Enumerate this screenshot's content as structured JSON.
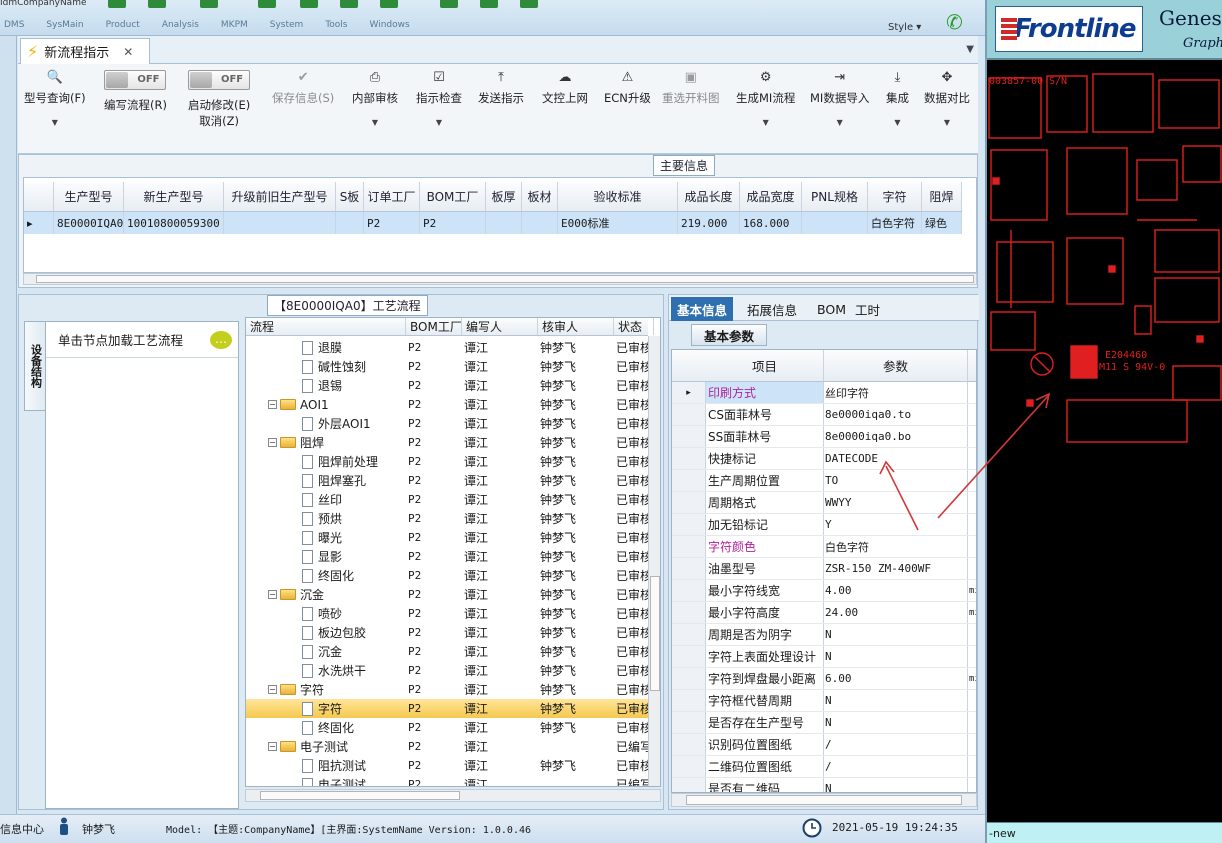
{
  "app": {
    "company": "IdmCompanyName",
    "menus": [
      "DMS",
      "SysMain",
      "Product",
      "Analysis",
      "MKPM",
      "System",
      "Tools",
      "Windows"
    ],
    "style_menu": "Style ▾"
  },
  "tab": {
    "title": "新流程指示",
    "close": "✕",
    "dropdown": "▼"
  },
  "toolbar": {
    "items": [
      {
        "label": "型号查询(F)",
        "icon": "🔍"
      },
      {
        "label": "编写流程(R)",
        "toggle": "OFF"
      },
      {
        "label": "启动修改(E)",
        "label2": "取消(Z)",
        "toggle": "OFF"
      },
      {
        "label": "保存信息(S)",
        "icon": "✔"
      },
      {
        "label": "内部审核",
        "icon": "⎙"
      },
      {
        "label": "指示检查",
        "icon": "☑"
      },
      {
        "label": "发送指示",
        "icon": "⤒"
      },
      {
        "label": "文控上网",
        "icon": "☁"
      },
      {
        "label": "ECN升级",
        "icon": "⚠"
      },
      {
        "label": "重选开料图",
        "icon": "▣"
      },
      {
        "label": "生成MI流程",
        "icon": "⚙"
      },
      {
        "label": "MI数据导入",
        "icon": "⇥"
      },
      {
        "label": "集成",
        "icon": "⤓"
      },
      {
        "label": "数据对比",
        "icon": "✥"
      }
    ]
  },
  "main_info": {
    "title": "主要信息",
    "columns": [
      "生产型号",
      "新生产型号",
      "升级前旧生产型号",
      "S板",
      "订单工厂",
      "BOM工厂",
      "板厚",
      "板材",
      "验收标准",
      "成品长度",
      "成品宽度",
      "PNL规格",
      "字符",
      "阻焊"
    ],
    "row": [
      "8E0000IQA0",
      "10010800059300",
      "",
      "",
      "P2",
      "P2",
      "",
      "",
      "E000标准",
      "219.000",
      "168.000",
      "",
      "白色字符",
      "绿色"
    ]
  },
  "process": {
    "title": "【8E0000IQA0】工艺流程",
    "vertical_tab": "设备结构",
    "left_header": "单击节点加载工艺流程",
    "columns": [
      "流程",
      "BOM工厂",
      "编写人",
      "核审人",
      "状态"
    ],
    "rows": [
      {
        "name": "退膜",
        "level": 1,
        "bom": "P2",
        "writer": "谭江",
        "reviewer": "钟梦飞",
        "status": "已审核"
      },
      {
        "name": "碱性蚀刻",
        "level": 1,
        "bom": "P2",
        "writer": "谭江",
        "reviewer": "钟梦飞",
        "status": "已审核"
      },
      {
        "name": "退锡",
        "level": 1,
        "bom": "P2",
        "writer": "谭江",
        "reviewer": "钟梦飞",
        "status": "已审核"
      },
      {
        "name": "AOI1",
        "level": 0,
        "bom": "P2",
        "writer": "谭江",
        "reviewer": "钟梦飞",
        "status": "已审核"
      },
      {
        "name": "外层AOI1",
        "level": 1,
        "bom": "P2",
        "writer": "谭江",
        "reviewer": "钟梦飞",
        "status": "已审核"
      },
      {
        "name": "阻焊",
        "level": 0,
        "bom": "P2",
        "writer": "谭江",
        "reviewer": "钟梦飞",
        "status": "已审核"
      },
      {
        "name": "阻焊前处理",
        "level": 1,
        "bom": "P2",
        "writer": "谭江",
        "reviewer": "钟梦飞",
        "status": "已审核"
      },
      {
        "name": "阻焊塞孔",
        "level": 1,
        "bom": "P2",
        "writer": "谭江",
        "reviewer": "钟梦飞",
        "status": "已审核"
      },
      {
        "name": "丝印",
        "level": 1,
        "bom": "P2",
        "writer": "谭江",
        "reviewer": "钟梦飞",
        "status": "已审核"
      },
      {
        "name": "预烘",
        "level": 1,
        "bom": "P2",
        "writer": "谭江",
        "reviewer": "钟梦飞",
        "status": "已审核"
      },
      {
        "name": "曝光",
        "level": 1,
        "bom": "P2",
        "writer": "谭江",
        "reviewer": "钟梦飞",
        "status": "已审核"
      },
      {
        "name": "显影",
        "level": 1,
        "bom": "P2",
        "writer": "谭江",
        "reviewer": "钟梦飞",
        "status": "已审核"
      },
      {
        "name": "终固化",
        "level": 1,
        "bom": "P2",
        "writer": "谭江",
        "reviewer": "钟梦飞",
        "status": "已审核"
      },
      {
        "name": "沉金",
        "level": 0,
        "bom": "P2",
        "writer": "谭江",
        "reviewer": "钟梦飞",
        "status": "已审核"
      },
      {
        "name": "喷砂",
        "level": 1,
        "bom": "P2",
        "writer": "谭江",
        "reviewer": "钟梦飞",
        "status": "已审核"
      },
      {
        "name": "板边包胶",
        "level": 1,
        "bom": "P2",
        "writer": "谭江",
        "reviewer": "钟梦飞",
        "status": "已审核"
      },
      {
        "name": "沉金",
        "level": 1,
        "bom": "P2",
        "writer": "谭江",
        "reviewer": "钟梦飞",
        "status": "已审核"
      },
      {
        "name": "水洗烘干",
        "level": 1,
        "bom": "P2",
        "writer": "谭江",
        "reviewer": "钟梦飞",
        "status": "已审核"
      },
      {
        "name": "字符",
        "level": 0,
        "bom": "P2",
        "writer": "谭江",
        "reviewer": "钟梦飞",
        "status": "已审核"
      },
      {
        "name": "字符",
        "level": 1,
        "bom": "P2",
        "writer": "谭江",
        "reviewer": "钟梦飞",
        "status": "已审核",
        "selected": true
      },
      {
        "name": "终固化",
        "level": 1,
        "bom": "P2",
        "writer": "谭江",
        "reviewer": "钟梦飞",
        "status": "已审核"
      },
      {
        "name": "电子测试",
        "level": 0,
        "bom": "P2",
        "writer": "谭江",
        "reviewer": "",
        "status": "已编写"
      },
      {
        "name": "阻抗测试",
        "level": 1,
        "bom": "P2",
        "writer": "谭江",
        "reviewer": "钟梦飞",
        "status": "已审核"
      },
      {
        "name": "电子测试",
        "level": 1,
        "bom": "P2",
        "writer": "谭江",
        "reviewer": "",
        "status": "已编写"
      }
    ]
  },
  "right_panel": {
    "tabs": [
      "基本信息",
      "拓展信息",
      "BOM",
      "工时"
    ],
    "subtab": "基本参数",
    "columns": [
      "项目",
      "参数"
    ],
    "rows": [
      {
        "key": "印刷方式",
        "value": "丝印字符",
        "magenta": true,
        "selected": true
      },
      {
        "key": "CS面菲林号",
        "value": "8e0000iqa0.to"
      },
      {
        "key": "SS面菲林号",
        "value": "8e0000iqa0.bo"
      },
      {
        "key": "快捷标记",
        "value": "DATECODE"
      },
      {
        "key": "生产周期位置",
        "value": "TO"
      },
      {
        "key": "周期格式",
        "value": "WWYY"
      },
      {
        "key": "加无铅标记",
        "value": "Y"
      },
      {
        "key": "字符颜色",
        "value": "白色字符",
        "magenta": true
      },
      {
        "key": "油墨型号",
        "value": "ZSR-150 ZM-400WF"
      },
      {
        "key": "最小字符线宽",
        "value": "4.00",
        "unit": "mi"
      },
      {
        "key": "最小字符高度",
        "value": "24.00",
        "unit": "mi"
      },
      {
        "key": "周期是否为阴字",
        "value": "N"
      },
      {
        "key": "字符上表面处理设计",
        "value": "N"
      },
      {
        "key": "字符到焊盘最小距离",
        "value": "6.00",
        "unit": "mi"
      },
      {
        "key": "字符框代替周期",
        "value": "N"
      },
      {
        "key": "是否存在生产型号",
        "value": "N"
      },
      {
        "key": "识别码位置图纸",
        "value": "/"
      },
      {
        "key": "二维码位置图纸",
        "value": "/"
      },
      {
        "key": "是否有二维码",
        "value": "N"
      }
    ]
  },
  "status": {
    "center": "信息中心",
    "user": "钟梦飞",
    "model": "Model: 【主题:CompanyName】[主界面:SystemName  Version: 1.0.0.46",
    "datetime": "2021-05-19 19:24:35"
  },
  "external": {
    "logo": "Frontline",
    "brand1": "Genes",
    "brand2": "Graph",
    "board_text": [
      "003857-00",
      "S/N",
      "E204460",
      "M11 S 94V-0"
    ],
    "footer": "-new"
  },
  "colors": {
    "accent": "#2e6fb0",
    "selection": "#cde3f7",
    "tree_selection": "#f5c94f",
    "magenta": "#b1239a",
    "board": "#e02020"
  }
}
